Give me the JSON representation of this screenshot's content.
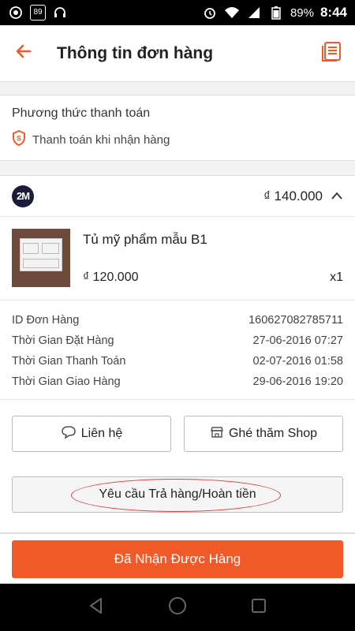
{
  "status_bar": {
    "sim_label": "89",
    "battery": "89%",
    "time": "8:44",
    "icons": [
      "whatsapp-icon",
      "sim-icon",
      "headset-icon",
      "alarm-icon",
      "wifi-icon",
      "signal-icon",
      "battery-icon"
    ]
  },
  "header": {
    "title": "Thông tin đơn hàng",
    "accent": "#f05a28"
  },
  "payment": {
    "label": "Phương thức thanh toán",
    "method": "Thanh toán khi nhận hàng"
  },
  "shop": {
    "logo_text": "2M",
    "total": "₫ 140.000"
  },
  "item": {
    "name": "Tủ mỹ phẩm mẫu B1",
    "price": "₫ 120.000",
    "qty": "x1"
  },
  "details": [
    {
      "label": "ID Đơn Hàng",
      "value": "160627082785711"
    },
    {
      "label": "Thời Gian Đặt Hàng",
      "value": "27-06-2016 07:27"
    },
    {
      "label": "Thời Gian Thanh Toán",
      "value": "02-07-2016 01:58"
    },
    {
      "label": "Thời Gian Giao Hàng",
      "value": "29-06-2016 19:20"
    }
  ],
  "actions": {
    "contact_label": "Liên hệ",
    "visit_shop_label": "Ghé thăm Shop",
    "return_label": "Yêu cầu Trả hàng/Hoàn tiền",
    "confirm_label": "Đã Nhận Được Hàng"
  },
  "colors": {
    "brand": "#f05a28",
    "annotation": "#e04040"
  }
}
